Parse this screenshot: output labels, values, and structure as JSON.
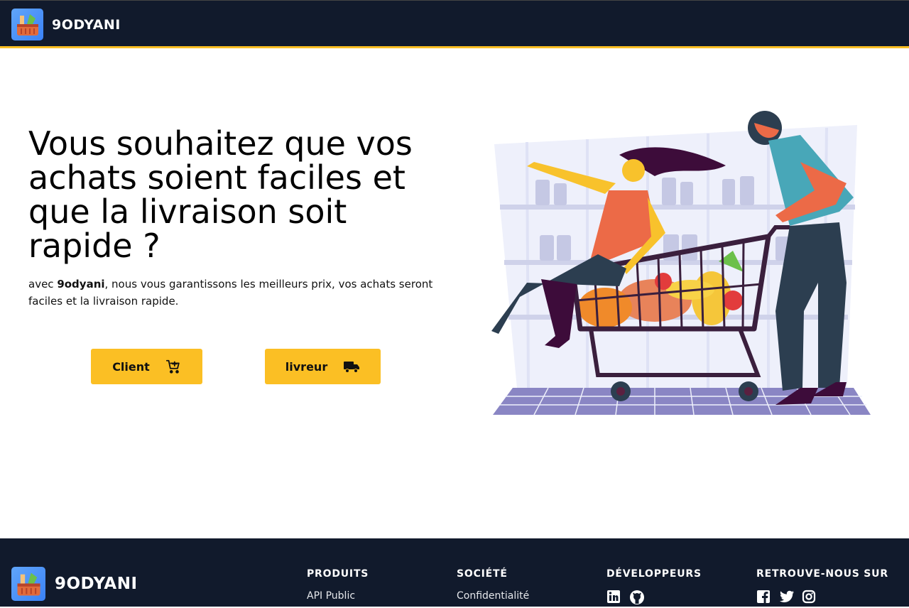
{
  "header": {
    "brand": "9ODYANI"
  },
  "hero": {
    "title": "Vous souhaitez que vos achats soient faciles et que la livraison soit rapide ?",
    "sub_prefix": "avec ",
    "sub_brand": "9odyani",
    "sub_rest": ", nous vous garantissons les meilleurs prix, vos achats seront faciles et la livraison rapide.",
    "btn_client": "Client",
    "btn_livreur": "livreur"
  },
  "footer": {
    "brand": "9ODYANI",
    "col1": {
      "head": "PRODUITS",
      "link": "API Public"
    },
    "col2": {
      "head": "SOCIÉTÉ",
      "link": "Confidentialité"
    },
    "col3": {
      "head": "DÉVELOPPEURS",
      "icons": [
        "linkedin-icon",
        "github-icon"
      ]
    },
    "col4": {
      "head": "RETROUVE-NOUS SUR",
      "icons": [
        "facebook-icon",
        "twitter-icon",
        "instagram-icon"
      ]
    }
  },
  "colors": {
    "navy": "#111a2c",
    "accent": "#fbbf24"
  }
}
